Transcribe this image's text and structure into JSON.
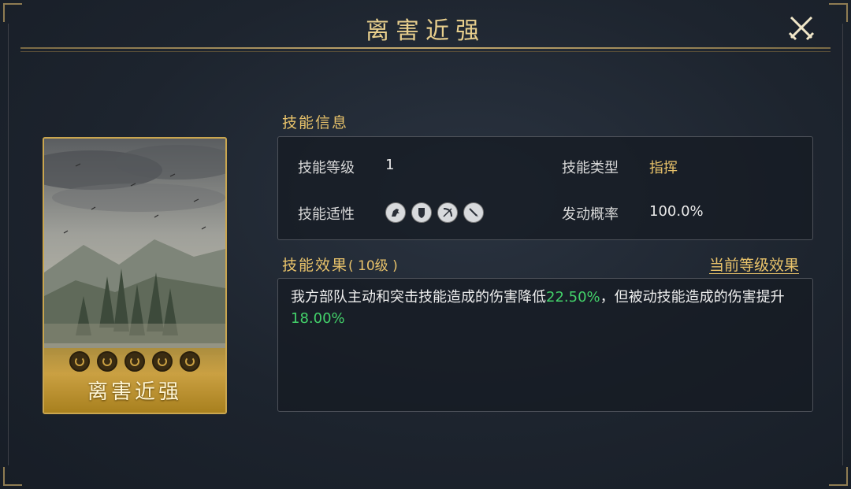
{
  "title": "离害近强",
  "card": {
    "name": "离害近强",
    "pips": 5
  },
  "skill_info": {
    "heading": "技能信息",
    "level_label": "技能等级",
    "level_value": "1",
    "type_label": "技能类型",
    "type_value": "指挥",
    "affinity_label": "技能适性",
    "affinity_icons": [
      "cavalry-icon",
      "shield-icon",
      "bow-icon",
      "spear-icon"
    ],
    "chance_label": "发动概率",
    "chance_value": "100.0%"
  },
  "effect": {
    "heading": "技能效果",
    "level_note": "( 10级 )",
    "current_level_link": "当前等级效果",
    "text_part1": "我方部队主动和突击技能造成的伤害降低",
    "value1": "22.50%",
    "text_part2": "，但被动技能造成的伤害提升",
    "value2": "18.00%"
  },
  "colors": {
    "gold": "#e8c26a",
    "green": "#43d26a",
    "card_border": "#caa64f"
  }
}
